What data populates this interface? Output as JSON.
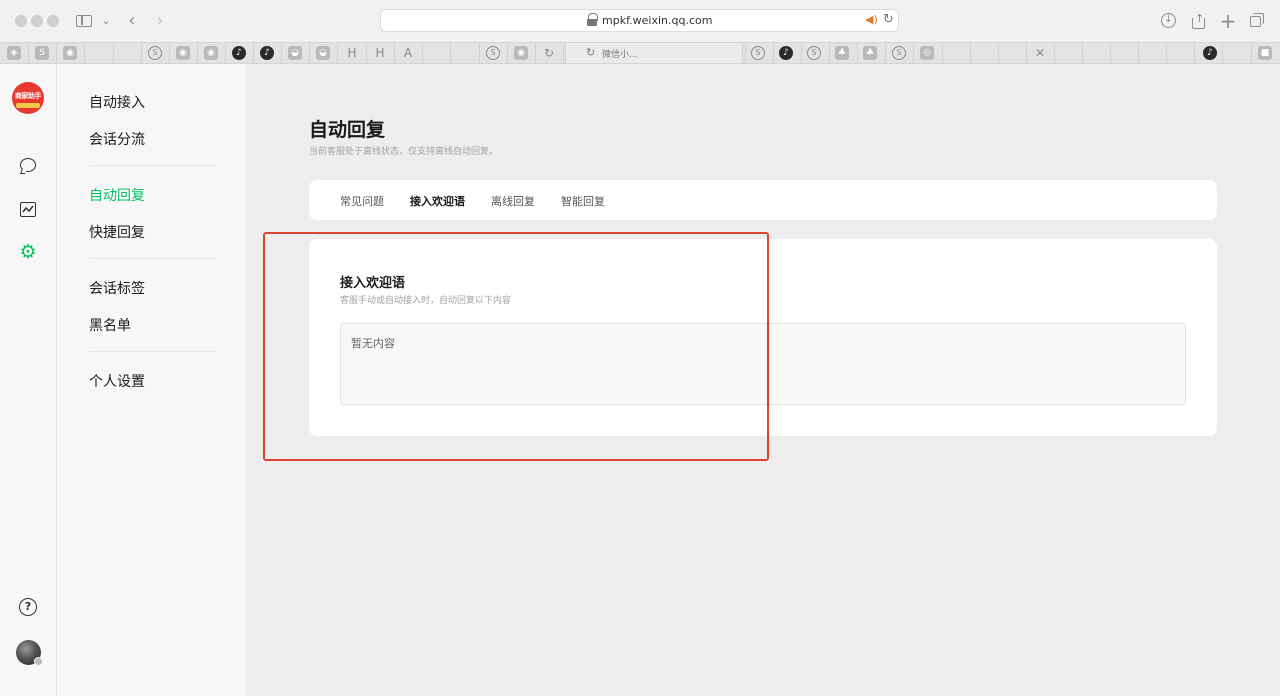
{
  "browser": {
    "url": "mpkf.weixin.qq.com",
    "active_tab_label": "微信小..."
  },
  "favorites": [
    {
      "icon": "stack-icon",
      "glyph": "◈"
    },
    {
      "icon": "s-icon",
      "glyph": "S"
    },
    {
      "icon": "wechat-icon",
      "glyph": "◉"
    },
    {
      "icon": "s-circle-icon",
      "glyph": "S"
    },
    {
      "icon": "wechat-icon",
      "glyph": "◉"
    },
    {
      "icon": "wechat-icon",
      "glyph": "◉"
    },
    {
      "icon": "tiktok-icon",
      "glyph": "♪"
    },
    {
      "icon": "tiktok-icon",
      "glyph": "♪"
    },
    {
      "icon": "chat-icon",
      "glyph": "◒"
    },
    {
      "icon": "chat-icon",
      "glyph": "◒"
    },
    {
      "icon": "h-icon",
      "glyph": "H"
    },
    {
      "icon": "h-icon",
      "glyph": "H"
    },
    {
      "icon": "a-icon",
      "glyph": "A"
    },
    {
      "icon": "s-circle-icon",
      "glyph": "S"
    },
    {
      "icon": "wechat-icon",
      "glyph": "◉"
    },
    {
      "icon": "refresh-icon",
      "glyph": "↻"
    },
    {
      "icon": "s-circle-icon",
      "glyph": "S"
    },
    {
      "icon": "tiktok-icon",
      "glyph": "♪"
    },
    {
      "icon": "s-circle-icon",
      "glyph": "S"
    },
    {
      "icon": "tree-icon",
      "glyph": "♣"
    },
    {
      "icon": "tree-icon",
      "glyph": "♣"
    },
    {
      "icon": "s-circle-icon",
      "glyph": "S"
    },
    {
      "icon": "eye-icon",
      "glyph": "◎"
    },
    {
      "icon": "x-icon",
      "glyph": "✕"
    },
    {
      "icon": "tiktok-icon",
      "glyph": "♪"
    },
    {
      "icon": "folder-icon",
      "glyph": "■"
    }
  ],
  "rail": {
    "logo_text": "商家助手",
    "icons": [
      "chat-icon",
      "stats-icon",
      "settings-icon",
      "help-icon"
    ],
    "accent_color": "#07c160"
  },
  "subnav": {
    "items": [
      {
        "label": "自动接入",
        "active": false
      },
      {
        "label": "会话分流",
        "active": false
      },
      {
        "label": "自动回复",
        "active": true
      },
      {
        "label": "快捷回复",
        "active": false
      },
      {
        "label": "会话标签",
        "active": false
      },
      {
        "label": "黑名单",
        "active": false
      },
      {
        "label": "个人设置",
        "active": false
      }
    ]
  },
  "main": {
    "title": "自动回复",
    "subtitle": "当前客服处于离线状态，仅支持离线自动回复。",
    "tabs": [
      {
        "label": "常见问题",
        "active": false
      },
      {
        "label": "接入欢迎语",
        "active": true
      },
      {
        "label": "离线回复",
        "active": false
      },
      {
        "label": "智能回复",
        "active": false
      }
    ],
    "section": {
      "title": "接入欢迎语",
      "description": "客服手动或自动接入时，自动回复以下内容",
      "empty_text": "暂无内容"
    }
  },
  "annotation": {
    "highlight_color": "#d9452f"
  }
}
